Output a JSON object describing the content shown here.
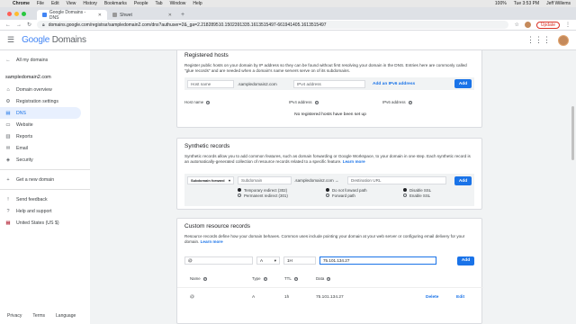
{
  "mac": {
    "apple": "",
    "app": "Chrome",
    "menus": [
      "File",
      "Edit",
      "View",
      "History",
      "Bookmarks",
      "People",
      "Tab",
      "Window",
      "Help"
    ],
    "battery": "100%",
    "clock": "Tue 3:53 PM",
    "user": "Jeff Willems"
  },
  "tabs": [
    {
      "title": "Google Domains - DNS"
    },
    {
      "title": "Shwet"
    }
  ],
  "url": "domains.google.com/registrar/sampledomain2.com/dns?authuser=2&_ga=2.218289510.1502391335.1613515497-661941405.1613515497",
  "update_label": "Update",
  "app": {
    "logo_google": "Google",
    "logo_domains": "Domains"
  },
  "sidebar": {
    "back": "All my domains",
    "domain": "sampledomain2.com",
    "items": [
      {
        "label": "Domain overview",
        "icon": "home-icon"
      },
      {
        "label": "Registration settings",
        "icon": "gear-icon"
      },
      {
        "label": "DNS",
        "icon": "dns-icon"
      },
      {
        "label": "Website",
        "icon": "web-icon"
      },
      {
        "label": "Reports",
        "icon": "reports-icon"
      },
      {
        "label": "Email",
        "icon": "email-icon"
      },
      {
        "label": "Security",
        "icon": "shield-icon"
      }
    ],
    "new_domain": "Get a new domain",
    "feedback": "Send feedback",
    "help": "Help and support",
    "country": "United States (US $)"
  },
  "footer": {
    "privacy": "Privacy",
    "terms": "Terms",
    "language": "Language"
  },
  "registered": {
    "title": "Registered hosts",
    "desc": "Register public hosts on your domain by IP address so they can be found without first resolving your domain in the DNS. Entries here are commonly called \"glue records\" and are needed when a domain's name servers serve on of its subdomains.",
    "host_placeholder": "Host name",
    "suffix": ".sampledomain2.com",
    "ip_placeholder": "IPv4 address",
    "add_ipv6": "Add an IPv6 address",
    "add": "Add",
    "col_host": "Host name",
    "col_ipv4": "IPv4 address",
    "col_ipv6": "IPv6 address",
    "empty": "No registered hosts have been set up"
  },
  "synthetic": {
    "title": "Synthetic records",
    "desc": "Synthetic records allow you to add common features, such as domain forwarding or Google Workspace, to your domain in one step. Each synthetic record is an automatically-generated collection of resource records related to a specific feature.",
    "learn": "Learn more",
    "type": "Subdomain forward",
    "sub_placeholder": "Subdomain",
    "suffix": ".sampledomain2.com →",
    "dest_placeholder": "Destination URL",
    "add": "Add",
    "r1": "Temporary redirect (302)",
    "r2": "Permanent redirect (301)",
    "p1": "Do not forward path",
    "p2": "Forward path",
    "s1": "Disable SSL",
    "s2": "Enable SSL"
  },
  "custom": {
    "title": "Custom resource records",
    "desc": "Resource records define how your domain behaves. Common uses include pointing your domain at your web server or configuring email delivery for your domain.",
    "learn": "Learn more",
    "name_val": "@",
    "type_val": "A",
    "ttl_val": "1H",
    "ip_val": "75.101.134.27",
    "add": "Add",
    "col_name": "Name",
    "col_type": "Type",
    "col_ttl": "TTL",
    "col_data": "Data",
    "row": {
      "name": "@",
      "type": "A",
      "ttl": "1h",
      "data": "75.101.134.27",
      "delete": "Delete",
      "edit": "Edit"
    }
  }
}
